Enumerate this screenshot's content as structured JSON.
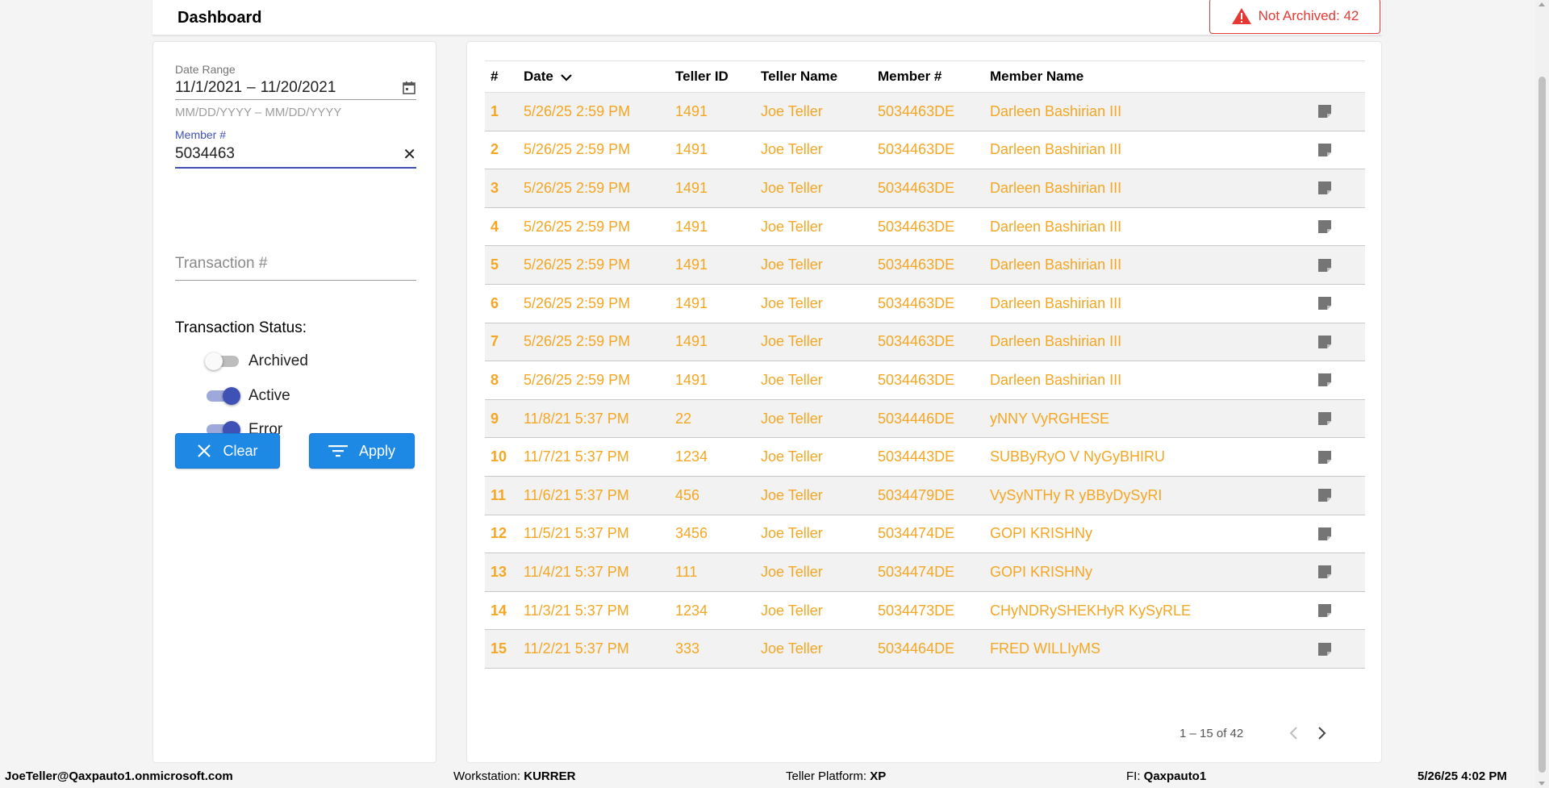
{
  "header": {
    "title": "Dashboard",
    "alert_text": "Not Archived: 42",
    "alert_color": "#e53935"
  },
  "filters": {
    "date_range_label": "Date Range",
    "date_start": "11/1/2021",
    "date_separator": "–",
    "date_end": "11/20/2021",
    "date_hint": "MM/DD/YYYY – MM/DD/YYYY",
    "member_label": "Member #",
    "member_value": "5034463",
    "transaction_placeholder": "Transaction #",
    "status_title": "Transaction Status:",
    "toggles": [
      {
        "label": "Archived",
        "on": false
      },
      {
        "label": "Active",
        "on": true
      },
      {
        "label": "Error",
        "on": true
      }
    ],
    "clear_label": "Clear",
    "apply_label": "Apply"
  },
  "table": {
    "headers": [
      "#",
      "Date",
      "Teller ID",
      "Teller Name",
      "Member #",
      "Member Name"
    ],
    "row_text_color": "#f5a623",
    "rows": [
      [
        "1",
        "5/26/25 2:59 PM",
        "1491",
        "Joe Teller",
        "5034463DE",
        "Darleen Bashirian III"
      ],
      [
        "2",
        "5/26/25 2:59 PM",
        "1491",
        "Joe Teller",
        "5034463DE",
        "Darleen Bashirian III"
      ],
      [
        "3",
        "5/26/25 2:59 PM",
        "1491",
        "Joe Teller",
        "5034463DE",
        "Darleen Bashirian III"
      ],
      [
        "4",
        "5/26/25 2:59 PM",
        "1491",
        "Joe Teller",
        "5034463DE",
        "Darleen Bashirian III"
      ],
      [
        "5",
        "5/26/25 2:59 PM",
        "1491",
        "Joe Teller",
        "5034463DE",
        "Darleen Bashirian III"
      ],
      [
        "6",
        "5/26/25 2:59 PM",
        "1491",
        "Joe Teller",
        "5034463DE",
        "Darleen Bashirian III"
      ],
      [
        "7",
        "5/26/25 2:59 PM",
        "1491",
        "Joe Teller",
        "5034463DE",
        "Darleen Bashirian III"
      ],
      [
        "8",
        "5/26/25 2:59 PM",
        "1491",
        "Joe Teller",
        "5034463DE",
        "Darleen Bashirian III"
      ],
      [
        "9",
        "11/8/21 5:37 PM",
        "22",
        "Joe Teller",
        "5034446DE",
        "yNNY VyRGHESE"
      ],
      [
        "10",
        "11/7/21 5:37 PM",
        "1234",
        "Joe Teller",
        "5034443DE",
        "SUBByRyO V NyGyBHIRU"
      ],
      [
        "11",
        "11/6/21 5:37 PM",
        "456",
        "Joe Teller",
        "5034479DE",
        "VySyNTHy R yBByDySyRI"
      ],
      [
        "12",
        "11/5/21 5:37 PM",
        "3456",
        "Joe Teller",
        "5034474DE",
        "GOPI KRISHNy"
      ],
      [
        "13",
        "11/4/21 5:37 PM",
        "111",
        "Joe Teller",
        "5034474DE",
        "GOPI KRISHNy"
      ],
      [
        "14",
        "11/3/21 5:37 PM",
        "1234",
        "Joe Teller",
        "5034473DE",
        "CHyNDRySHEKHyR KySyRLE"
      ],
      [
        "15",
        "11/2/21 5:37 PM",
        "333",
        "Joe Teller",
        "5034464DE",
        "FRED WILLIyMS"
      ]
    ],
    "row_icon": "note-icon"
  },
  "pagination": {
    "range_text": "1 – 15 of 42"
  },
  "statusbar": {
    "user": "JoeTeller@Qaxpauto1.onmicrosoft.com",
    "workstation_label": "Workstation:",
    "workstation_value": "KURRER",
    "platform_label": "Teller Platform:",
    "platform_value": "XP",
    "fi_label": "FI:",
    "fi_value": "Qaxpauto1",
    "datetime": "5/26/25 4:02 PM"
  }
}
